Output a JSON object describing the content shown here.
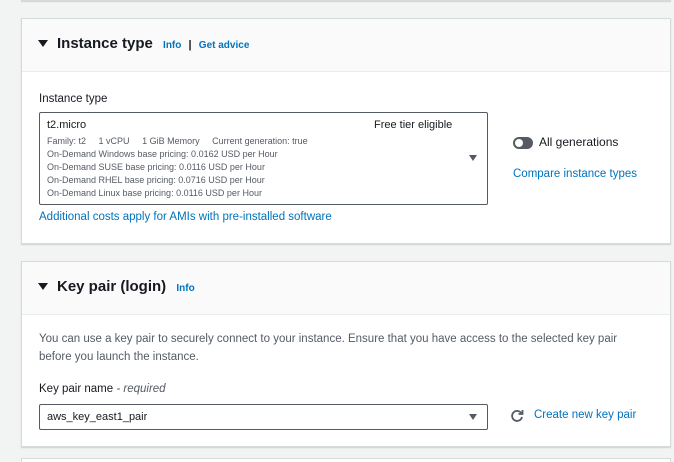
{
  "instance_type": {
    "title": "Instance type",
    "info_link": "Info",
    "separator": "|",
    "advice_link": "Get advice",
    "field_label": "Instance type",
    "selected": {
      "name": "t2.micro",
      "badge": "Free tier eligible",
      "family": "Family: t2",
      "vcpu": "1 vCPU",
      "memory": "1 GiB Memory",
      "generation": "Current generation: true",
      "pricing": [
        "On-Demand Windows base pricing: 0.0162 USD per Hour",
        "On-Demand SUSE base pricing: 0.0116 USD per Hour",
        "On-Demand RHEL base pricing: 0.0716 USD per Hour",
        "On-Demand Linux base pricing: 0.0116 USD per Hour"
      ]
    },
    "toggle_label": "All generations",
    "toggle_on": false,
    "compare_link": "Compare instance types",
    "costs_link": "Additional costs apply for AMIs with pre-installed software"
  },
  "key_pair": {
    "title": "Key pair (login)",
    "info_link": "Info",
    "description": "You can use a key pair to securely connect to your instance. Ensure that you have access to the selected key pair before you launch the instance.",
    "field_label": "Key pair name",
    "required_text": "- required",
    "selected_value": "aws_key_east1_pair",
    "create_link": "Create new key pair"
  },
  "colors": {
    "link": "#0073bb",
    "text": "#16191f",
    "secondary_text": "#545b64",
    "background": "#f2f3f3"
  }
}
